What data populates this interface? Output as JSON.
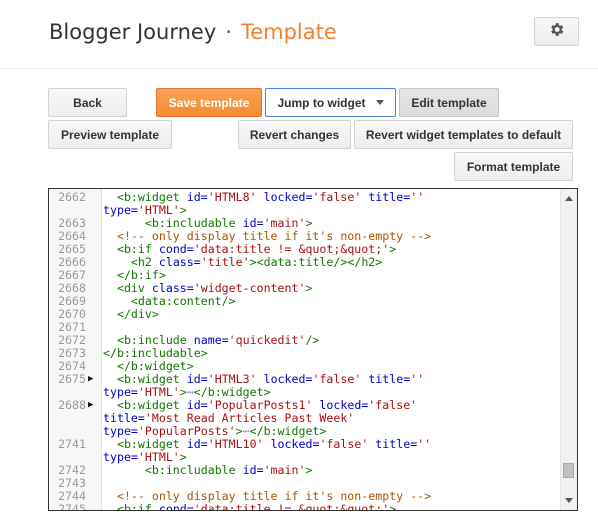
{
  "header": {
    "blog_name": "Blogger Journey",
    "separator": "·",
    "section": "Template",
    "settings_icon": "gear-icon"
  },
  "toolbar": {
    "back": "Back",
    "save": "Save template",
    "jump": "Jump to widget",
    "edit": "Edit template",
    "preview": "Preview template",
    "revert_changes": "Revert changes",
    "revert_widgets": "Revert widget templates to default",
    "format": "Format template"
  },
  "colors": {
    "accent": "#f0822f",
    "save_button": "#f48b31",
    "tag": "#117700",
    "attribute": "#0000cc",
    "string": "#aa1111",
    "comment": "#aa5500"
  },
  "editor": {
    "fold_marker_icon": "triangle-right-icon",
    "lines": [
      {
        "num": "2662",
        "marker": "",
        "html": "  <span class='t'>&lt;b:widget</span> <span class='a'>id=</span><span class='s'>'HTML8'</span> <span class='a'>locked=</span><span class='s'>'false'</span> <span class='a'>title=</span><span class='s'>''</span>"
      },
      {
        "num": "",
        "marker": "",
        "html": "<span class='a'>type=</span><span class='s'>'HTML'</span><span class='t'>&gt;</span>"
      },
      {
        "num": "2663",
        "marker": "",
        "html": "      <span class='t'>&lt;b:includable</span> <span class='a'>id=</span><span class='s'>'main'</span><span class='t'>&gt;</span>"
      },
      {
        "num": "2664",
        "marker": "",
        "html": "  <span class='cm'>&lt;!-- only display title if it's non-empty --&gt;</span>"
      },
      {
        "num": "2665",
        "marker": "",
        "html": "  <span class='t'>&lt;b:if</span> <span class='a'>cond=</span><span class='s'>'data:title != &amp;quot;&amp;quot;'</span><span class='t'>&gt;</span>"
      },
      {
        "num": "2666",
        "marker": "",
        "html": "    <span class='t'>&lt;h2</span> <span class='a'>class=</span><span class='s'>'title'</span><span class='t'>&gt;</span><span class='t'>&lt;data:title/&gt;</span><span class='t'>&lt;/h2&gt;</span>"
      },
      {
        "num": "2667",
        "marker": "",
        "html": "  <span class='t'>&lt;/b:if&gt;</span>"
      },
      {
        "num": "2668",
        "marker": "",
        "html": "  <span class='t'>&lt;div</span> <span class='a'>class=</span><span class='s'>'widget-content'</span><span class='t'>&gt;</span>"
      },
      {
        "num": "2669",
        "marker": "",
        "html": "    <span class='t'>&lt;data:content/&gt;</span>"
      },
      {
        "num": "2670",
        "marker": "",
        "html": "  <span class='t'>&lt;/div&gt;</span>"
      },
      {
        "num": "2671",
        "marker": "",
        "html": ""
      },
      {
        "num": "2672",
        "marker": "",
        "html": "  <span class='t'>&lt;b:include</span> <span class='a'>name=</span><span class='s'>'quickedit'</span><span class='t'>/&gt;</span>"
      },
      {
        "num": "2673",
        "marker": "",
        "html": "<span class='t'>&lt;/b:includable&gt;</span>"
      },
      {
        "num": "2674",
        "marker": "",
        "html": "  <span class='t'>&lt;/b:widget&gt;</span>"
      },
      {
        "num": "2675",
        "marker": "▶",
        "html": "  <span class='t'>&lt;b:widget</span> <span class='a'>id=</span><span class='s'>'HTML3'</span> <span class='a'>locked=</span><span class='s'>'false'</span> <span class='a'>title=</span><span class='s'>''</span>"
      },
      {
        "num": "",
        "marker": "",
        "html": "<span class='a'>type=</span><span class='s'>'HTML'</span><span class='t'>&gt;</span><span class='fold'>⋯</span><span class='t'>&lt;/b:widget&gt;</span>"
      },
      {
        "num": "2688",
        "marker": "▶",
        "html": "  <span class='t'>&lt;b:widget</span> <span class='a'>id=</span><span class='s'>'PopularPosts1'</span> <span class='a'>locked=</span><span class='s'>'false'</span>"
      },
      {
        "num": "",
        "marker": "",
        "html": "<span class='a'>title=</span><span class='s'>'Most Read Articles Past Week'</span>"
      },
      {
        "num": "",
        "marker": "",
        "html": "<span class='a'>type=</span><span class='s'>'PopularPosts'</span><span class='t'>&gt;</span><span class='fold'>⋯</span><span class='t'>&lt;/b:widget&gt;</span>"
      },
      {
        "num": "2741",
        "marker": "",
        "html": "  <span class='t'>&lt;b:widget</span> <span class='a'>id=</span><span class='s'>'HTML10'</span> <span class='a'>locked=</span><span class='s'>'false'</span> <span class='a'>title=</span><span class='s'>''</span>"
      },
      {
        "num": "",
        "marker": "",
        "html": "<span class='a'>type=</span><span class='s'>'HTML'</span><span class='t'>&gt;</span>"
      },
      {
        "num": "2742",
        "marker": "",
        "html": "      <span class='t'>&lt;b:includable</span> <span class='a'>id=</span><span class='s'>'main'</span><span class='t'>&gt;</span>"
      },
      {
        "num": "2743",
        "marker": "",
        "html": ""
      },
      {
        "num": "2744",
        "marker": "",
        "html": "  <span class='cm'>&lt;!-- only display title if it's non-empty --&gt;</span>"
      },
      {
        "num": "2745",
        "marker": "",
        "html": "  <span class='t'>&lt;b:if</span> <span class='a'>cond=</span><span class='s'>'data:title != &amp;quot;&amp;quot;'</span><span class='t'>&gt;</span>"
      }
    ]
  }
}
